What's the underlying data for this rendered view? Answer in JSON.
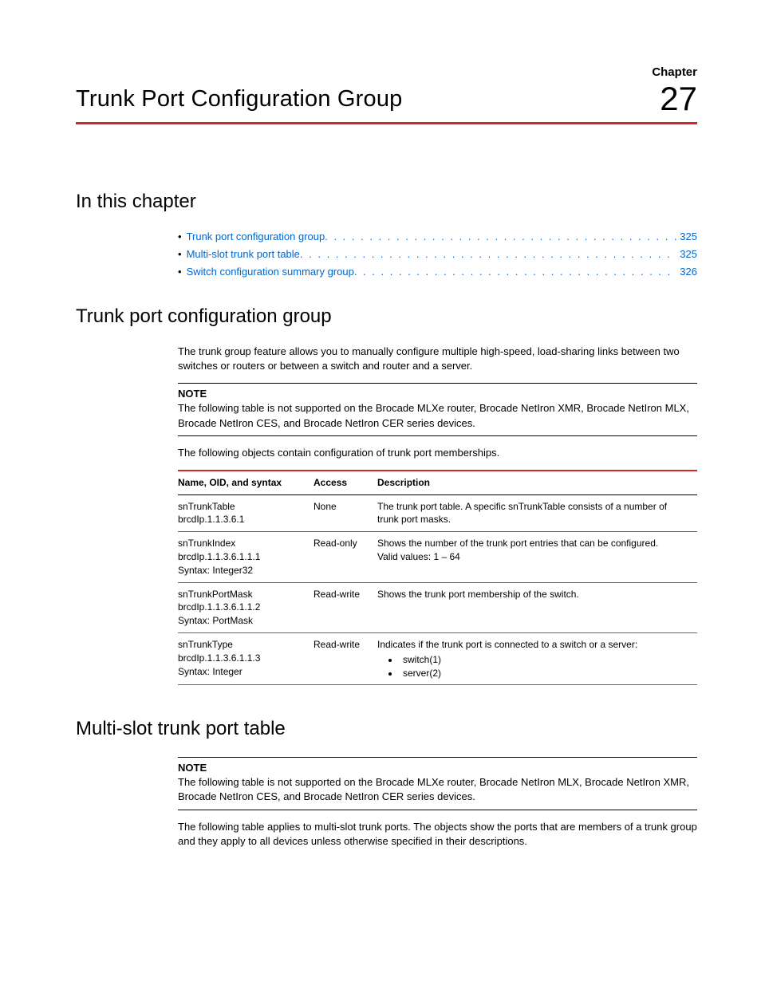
{
  "header": {
    "chapter_word": "Chapter",
    "title": "Trunk Port Configuration Group",
    "number": "27"
  },
  "sections": {
    "in_this_chapter": "In this chapter",
    "trunk_group": "Trunk port configuration group",
    "multi_slot": "Multi-slot trunk port table"
  },
  "toc": [
    {
      "label": "Trunk port configuration group",
      "page": "325"
    },
    {
      "label": "Multi-slot trunk port table",
      "page": "325"
    },
    {
      "label": "Switch configuration summary group",
      "page": "326"
    }
  ],
  "trunk": {
    "intro": "The trunk group feature allows you to manually configure multiple high-speed, load-sharing links between two switches or routers or between a switch and router and a server.",
    "note_label": "NOTE",
    "note_text": "The following table is not supported on the Brocade MLXe router, Brocade NetIron XMR, Brocade NetIron MLX, Brocade NetIron CES, and Brocade NetIron CER series devices.",
    "lead": "The following objects contain configuration of trunk port memberships.",
    "headers": {
      "c1": "Name, OID, and syntax",
      "c2": "Access",
      "c3": "Description"
    },
    "rows": [
      {
        "name": "snTrunkTable\nbrcdIp.1.1.3.6.1",
        "access": "None",
        "desc": "The trunk port table. A specific snTrunkTable consists of a number of trunk port masks."
      },
      {
        "name": "snTrunkIndex\nbrcdIp.1.1.3.6.1.1.1\nSyntax: Integer32",
        "access": "Read-only",
        "desc": "Shows the number of the trunk port entries that can be configured.\nValid values: 1 – 64"
      },
      {
        "name": "snTrunkPortMask\nbrcdIp.1.1.3.6.1.1.2\nSyntax: PortMask",
        "access": "Read-write",
        "desc": "Shows the trunk port membership of the switch."
      },
      {
        "name": "snTrunkType\nbrcdIp.1.1.3.6.1.1.3\nSyntax: Integer",
        "access": "Read-write",
        "desc": "Indicates if the trunk port is connected to a switch or a server:",
        "list": [
          "switch(1)",
          "server(2)"
        ]
      }
    ]
  },
  "multi": {
    "note_label": "NOTE",
    "note_text": "The following table is not supported on the Brocade MLXe router, Brocade NetIron MLX, Brocade NetIron XMR, Brocade NetIron CES, and Brocade NetIron CER series devices.",
    "lead": "The following table applies to multi-slot trunk ports. The objects show the ports that are members of a trunk group and they apply to all devices unless otherwise specified in their descriptions."
  }
}
